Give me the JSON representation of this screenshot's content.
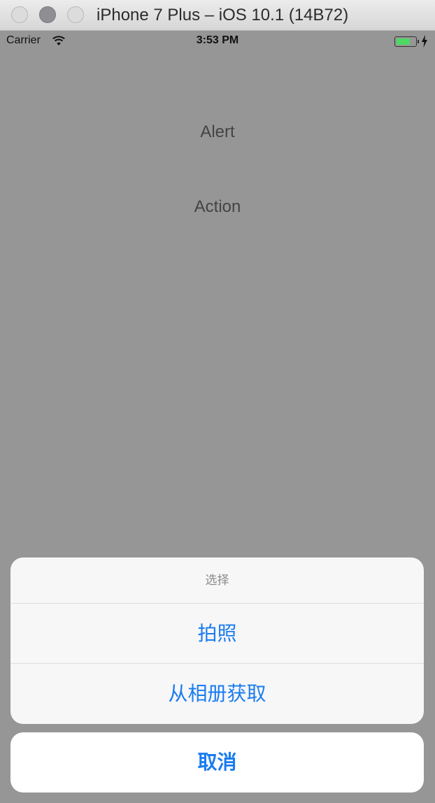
{
  "window": {
    "title": "iPhone 7 Plus – iOS 10.1 (14B72)"
  },
  "status_bar": {
    "carrier": "Carrier",
    "time": "3:53 PM",
    "battery_level": 0.75,
    "charging": true
  },
  "main": {
    "buttons": [
      {
        "label": "Alert"
      },
      {
        "label": "Action"
      }
    ]
  },
  "action_sheet": {
    "title": "选择",
    "actions": [
      {
        "label": "拍照"
      },
      {
        "label": "从相册获取"
      }
    ],
    "cancel_label": "取消"
  },
  "colors": {
    "overlay": "#969696",
    "accent": "#1a7cf0",
    "battery": "#4cd964"
  },
  "icons": [
    "wifi-icon",
    "battery-icon",
    "charging-bolt-icon"
  ]
}
